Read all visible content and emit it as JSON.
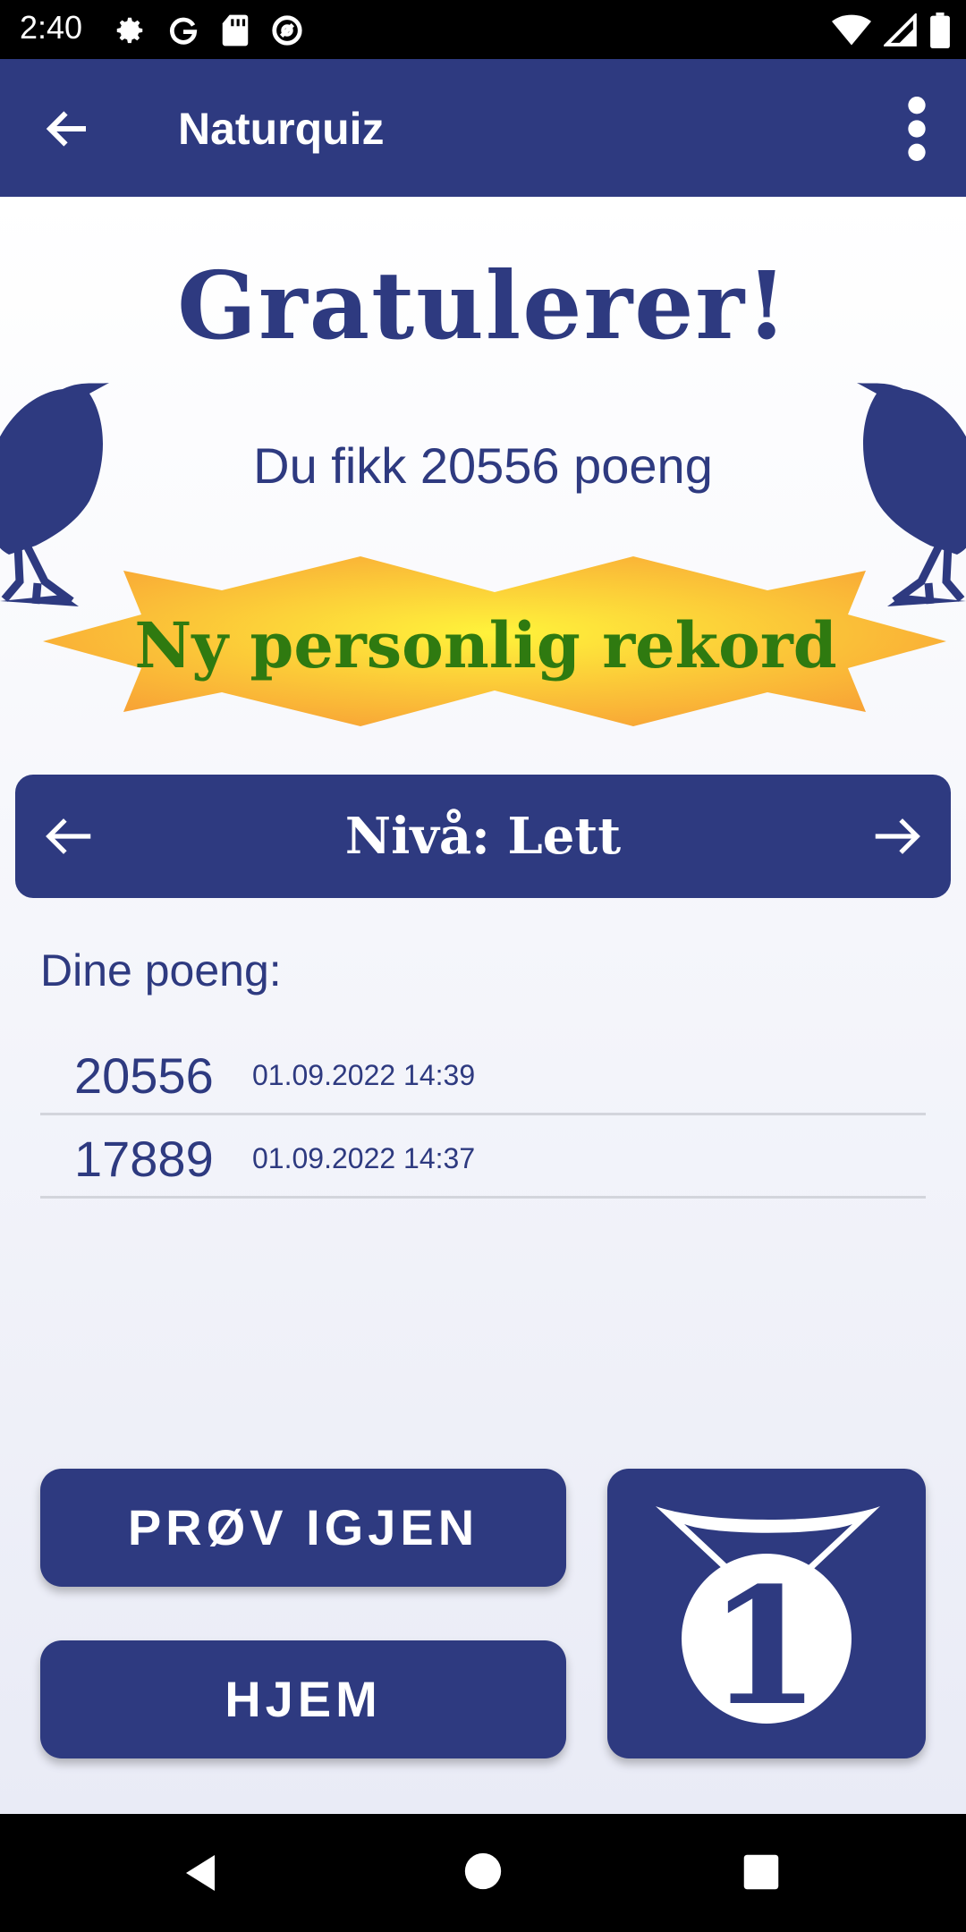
{
  "status_bar": {
    "time": "2:40",
    "icons_left": [
      "gear-icon",
      "google-icon",
      "sd-card-icon",
      "at-sign-icon"
    ],
    "icons_right": [
      "wifi-icon",
      "cell-signal-icon",
      "battery-icon"
    ]
  },
  "app_bar": {
    "title": "Naturquiz",
    "back_icon": "arrow-left-icon",
    "menu_icon": "more-vert-icon"
  },
  "result": {
    "heading": "Gratulerer!",
    "score_text": "Du fikk 20556 poeng",
    "record_text": "Ny personlig rekord"
  },
  "level_selector": {
    "label": "Nivå: Lett",
    "prev_icon": "arrow-left-icon",
    "next_icon": "arrow-right-icon"
  },
  "scores": {
    "heading": "Dine poeng:",
    "rows": [
      {
        "value": "20556",
        "date": "01.09.2022 14:39"
      },
      {
        "value": "17889",
        "date": "01.09.2022 14:37"
      }
    ]
  },
  "buttons": {
    "retry": "PRØV IGJEN",
    "home": "HJEM",
    "highscore_icon": "medal-first-place-icon"
  },
  "colors": {
    "primary": "#2e3a80",
    "record_text": "#2f7a10",
    "burst": "#fbb836"
  }
}
